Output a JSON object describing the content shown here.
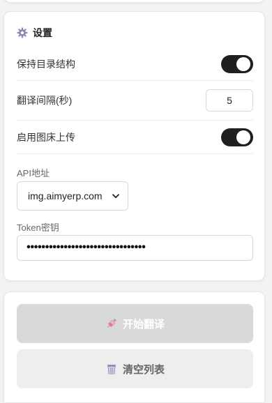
{
  "settings": {
    "title": "设置",
    "icon": "gear-icon",
    "keep_structure": {
      "label": "保持目录结构",
      "enabled": true
    },
    "interval": {
      "label": "翻译间隔(秒)",
      "value": "5"
    },
    "image_host": {
      "label": "启用图床上传",
      "enabled": true
    },
    "api": {
      "label": "API地址",
      "selected": "img.aimyerp.com"
    },
    "token": {
      "label": "Token密钥",
      "masked_value": "••••••••••••••••••••••••••••••••"
    }
  },
  "actions": {
    "start_label": "开始翻译",
    "start_icon": "syringe-icon",
    "clear_label": "清空列表",
    "clear_icon": "wastebasket-icon"
  },
  "colors": {
    "toggle_on": "#1f1f1f",
    "start_button_disabled": "#d9d9d9",
    "clear_button": "#eeeeee"
  }
}
